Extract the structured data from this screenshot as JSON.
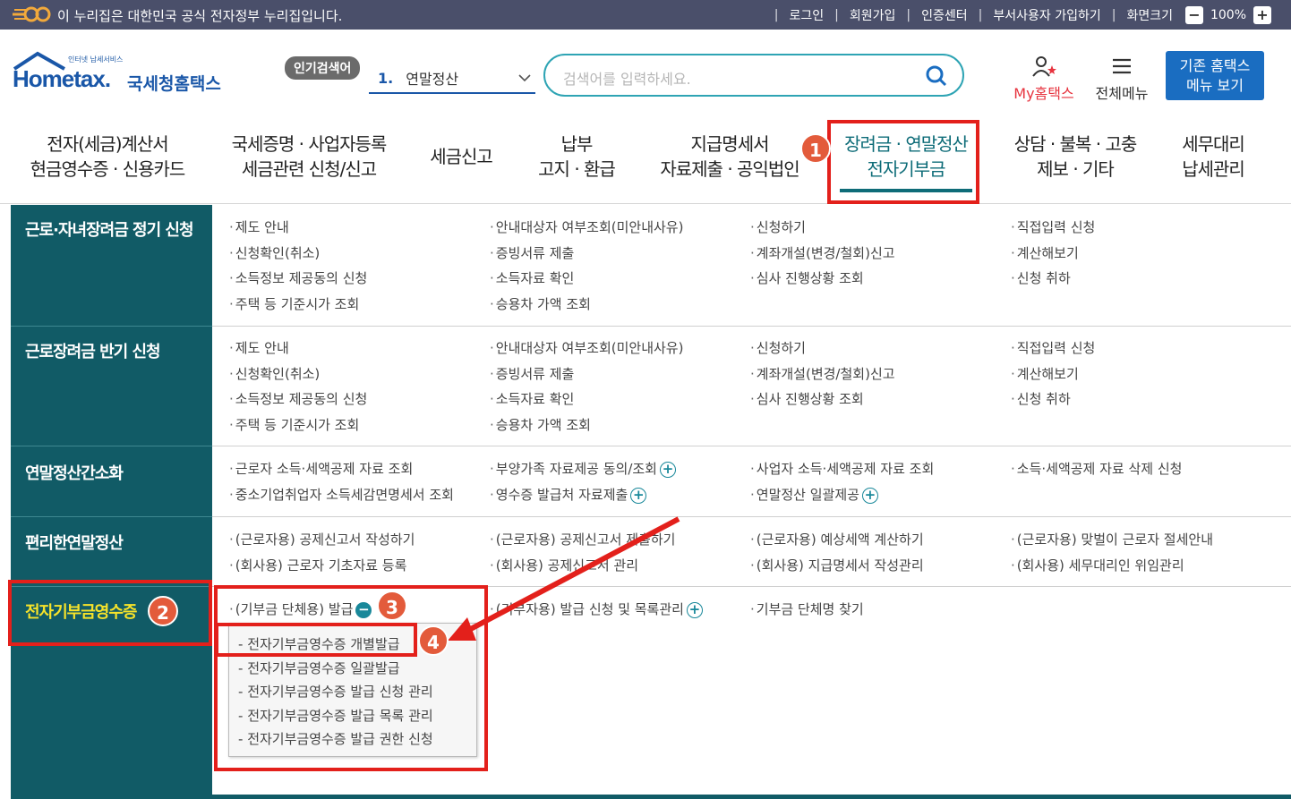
{
  "govbar": {
    "notice": "이 누리집은 대한민국 공식 전자정부 누리집입니다.",
    "links": [
      "로그인",
      "회원가입",
      "인증센터",
      "부서사용자 가입하기",
      "화면크기"
    ],
    "zoom": "100%"
  },
  "header": {
    "logo_sub": "인터넷 납세서비스",
    "logo_home": "Hometax.",
    "logo_kor": "국세청홈택스",
    "popular_label": "인기검색어",
    "keyword_num": "1.",
    "keyword": "연말정산",
    "search_placeholder": "검색어를 입력하세요.",
    "my_home": "My홈택스",
    "all_menu": "전체메뉴",
    "old_hometax_line1": "기존 홈택스",
    "old_hometax_line2": "메뉴 보기"
  },
  "gnb": [
    {
      "line1": "전자(세금)계산서",
      "line2": "현금영수증 · 신용카드"
    },
    {
      "line1": "국세증명 · 사업자등록",
      "line2": "세금관련 신청/신고"
    },
    {
      "line1": "세금신고",
      "line2": ""
    },
    {
      "line1": "납부",
      "line2": "고지 · 환급"
    },
    {
      "line1": "지급명세서",
      "line2": "자료제출 · 공익법인"
    },
    {
      "line1": "장려금 · 연말정산",
      "line2": "전자기부금"
    },
    {
      "line1": "상담 · 불복 · 고충",
      "line2": "제보 · 기타"
    },
    {
      "line1": "세무대리",
      "line2": "납세관리"
    }
  ],
  "sections": [
    {
      "title": "근로·자녀장려금 정기 신청",
      "cols": [
        [
          "제도 안내",
          "신청확인(취소)",
          "소득정보 제공동의 신청",
          "주택 등 기준시가 조회"
        ],
        [
          "안내대상자 여부조회(미안내사유)",
          "증빙서류 제출",
          "소득자료 확인",
          "승용차 가액 조회"
        ],
        [
          "신청하기",
          "계좌개설(변경/철회)신고",
          "심사 진행상황 조회"
        ],
        [
          "직접입력 신청",
          "계산해보기",
          "신청 취하"
        ]
      ]
    },
    {
      "title": "근로장려금 반기 신청",
      "cols": [
        [
          "제도 안내",
          "신청확인(취소)",
          "소득정보 제공동의 신청",
          "주택 등 기준시가 조회"
        ],
        [
          "안내대상자 여부조회(미안내사유)",
          "증빙서류 제출",
          "소득자료 확인",
          "승용차 가액 조회"
        ],
        [
          "신청하기",
          "계좌개설(변경/철회)신고",
          "심사 진행상황 조회"
        ],
        [
          "직접입력 신청",
          "계산해보기",
          "신청 취하"
        ]
      ]
    },
    {
      "title": "연말정산간소화",
      "cols": [
        [
          "근로자 소득·세액공제 자료 조회",
          "중소기업취업자 소득세감면명세서 조회"
        ],
        [
          "부양가족 자료제공 동의/조회",
          "영수증 발급처 자료제출"
        ],
        [
          "사업자 소득·세액공제 자료 조회",
          "연말정산 일괄제공"
        ],
        [
          "소득·세액공제 자료 삭제 신청"
        ]
      ]
    },
    {
      "title": "편리한연말정산",
      "cols": [
        [
          "(근로자용) 공제신고서 작성하기",
          "(회사용) 근로자 기초자료 등록"
        ],
        [
          "(근로자용) 공제신고서 제출하기",
          "(회사용) 공제신고서 관리"
        ],
        [
          "(근로자용) 예상세액 계산하기",
          "(회사용) 지급명세서 작성관리"
        ],
        [
          "(근로자용) 맞벌이 근로자 절세안내",
          "(회사용) 세무대리인 위임관리"
        ]
      ]
    },
    {
      "title": "전자기부금영수증",
      "cols": [
        [
          "(기부금 단체용) 발급"
        ],
        [
          "(기부자용) 발급 신청 및 목록관리"
        ],
        [
          "기부금 단체명 찾기"
        ]
      ],
      "dropdown": [
        "전자기부금영수증 개별발급",
        "전자기부금영수증 일괄발급",
        "전자기부금영수증 발급 신청 관리",
        "전자기부금영수증 발급 목록 관리",
        "전자기부금영수증 발급 권한 신청"
      ]
    }
  ],
  "badges": [
    "1",
    "2",
    "3",
    "4"
  ],
  "colors": {
    "accent": "#115b66",
    "annotation": "#e3201b",
    "badge": "#e35b3b"
  }
}
